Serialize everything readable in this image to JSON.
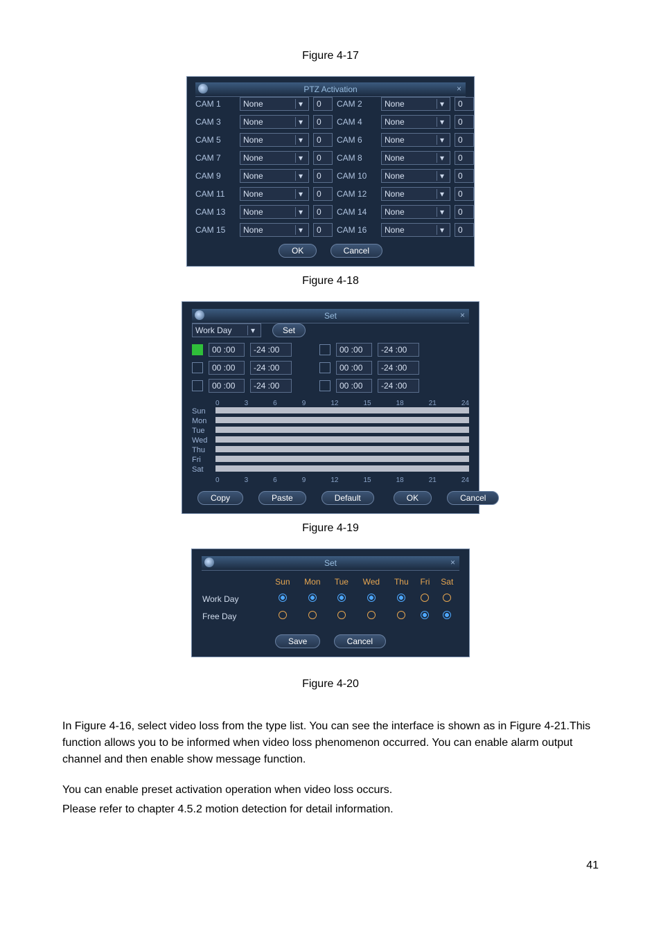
{
  "captions": {
    "fig17": "Figure 4-17",
    "fig18": "Figure 4-18",
    "fig19": "Figure 4-19",
    "fig20": "Figure 4-20"
  },
  "ptz": {
    "title": "PTZ Activation",
    "ok": "OK",
    "cancel": "Cancel",
    "rows": [
      {
        "l": "CAM 1",
        "lsel": "None",
        "lnum": "0",
        "r": "CAM 2",
        "rsel": "None",
        "rnum": "0"
      },
      {
        "l": "CAM 3",
        "lsel": "None",
        "lnum": "0",
        "r": "CAM 4",
        "rsel": "None",
        "rnum": "0"
      },
      {
        "l": "CAM 5",
        "lsel": "None",
        "lnum": "0",
        "r": "CAM 6",
        "rsel": "None",
        "rnum": "0"
      },
      {
        "l": "CAM 7",
        "lsel": "None",
        "lnum": "0",
        "r": "CAM 8",
        "rsel": "None",
        "rnum": "0"
      },
      {
        "l": "CAM 9",
        "lsel": "None",
        "lnum": "0",
        "r": "CAM 10",
        "rsel": "None",
        "rnum": "0"
      },
      {
        "l": "CAM 11",
        "lsel": "None",
        "lnum": "0",
        "r": "CAM 12",
        "rsel": "None",
        "rnum": "0"
      },
      {
        "l": "CAM 13",
        "lsel": "None",
        "lnum": "0",
        "r": "CAM 14",
        "rsel": "None",
        "rnum": "0"
      },
      {
        "l": "CAM 15",
        "lsel": "None",
        "lnum": "0",
        "r": "CAM 16",
        "rsel": "None",
        "rnum": "0"
      }
    ]
  },
  "set": {
    "title": "Set",
    "daytype": "Work Day",
    "setbtn": "Set",
    "rows": [
      {
        "a_on": true,
        "a_s": "00 :00",
        "a_e": "-24 :00",
        "b_on": false,
        "b_s": "00 :00",
        "b_e": "-24 :00"
      },
      {
        "a_on": false,
        "a_s": "00 :00",
        "a_e": "-24 :00",
        "b_on": false,
        "b_s": "00 :00",
        "b_e": "-24 :00"
      },
      {
        "a_on": false,
        "a_s": "00 :00",
        "a_e": "-24 :00",
        "b_on": false,
        "b_s": "00 :00",
        "b_e": "-24 :00"
      }
    ],
    "days": [
      "Sun",
      "Mon",
      "Tue",
      "Wed",
      "Thu",
      "Fri",
      "Sat"
    ],
    "ticks": [
      "0",
      "3",
      "6",
      "9",
      "12",
      "15",
      "18",
      "21",
      "24"
    ],
    "btns": {
      "copy": "Copy",
      "paste": "Paste",
      "default": "Default",
      "ok": "OK",
      "cancel": "Cancel"
    }
  },
  "daysel": {
    "title": "Set",
    "headers": [
      "",
      "Sun",
      "Mon",
      "Tue",
      "Wed",
      "Thu",
      "Fri",
      "Sat"
    ],
    "rows": [
      {
        "label": "Work Day",
        "cells": [
          "on",
          "on",
          "on",
          "on",
          "on",
          "ring",
          "ring"
        ]
      },
      {
        "label": "Free Day",
        "cells": [
          "ring",
          "ring",
          "ring",
          "ring",
          "ring",
          "on",
          "on"
        ]
      }
    ],
    "save": "Save",
    "cancel": "Cancel"
  },
  "body": {
    "p1": "In Figure 4-16, select video loss from the type list. You can see the interface is shown as in Figure 4-21.This function allows you to be informed when video loss phenomenon occurred. You can enable alarm output channel and then enable show message function.",
    "p2": "You can enable preset activation operation when video loss occurs.",
    "p3": "Please refer to chapter 4.5.2 motion detection for detail information."
  },
  "page": "41"
}
